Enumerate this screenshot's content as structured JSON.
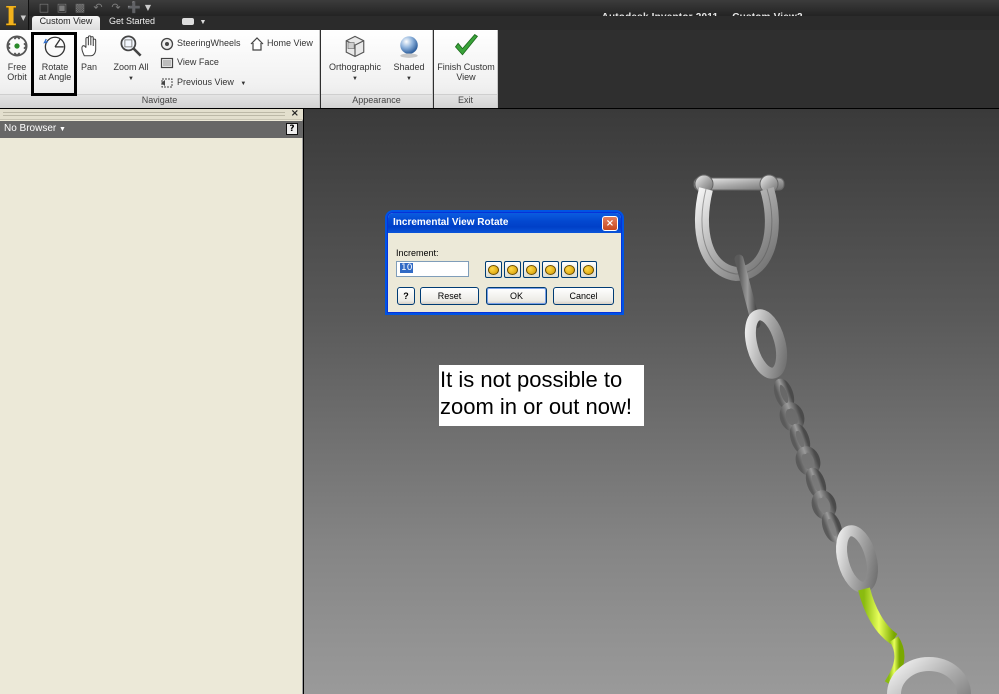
{
  "titlebar": {
    "app_name": "Autodesk Inventor 2011",
    "document": "Custom View2"
  },
  "tabs": [
    {
      "label": "Custom View",
      "active": true
    },
    {
      "label": "Get Started",
      "active": false
    }
  ],
  "ribbon": {
    "navigate": {
      "title": "Navigate",
      "free_orbit": [
        "Free",
        "Orbit"
      ],
      "rotate_at_angle": [
        "Rotate",
        "at Angle"
      ],
      "pan": "Pan",
      "zoom_all": "Zoom All",
      "steering_wheels": "SteeringWheels",
      "home_view": "Home View",
      "view_face": "View Face",
      "previous_view": "Previous View"
    },
    "appearance": {
      "title": "Appearance",
      "orthographic": "Orthographic",
      "shaded": "Shaded"
    },
    "exit": {
      "title": "Exit",
      "finish_custom_view": [
        "Finish Custom",
        "View"
      ]
    }
  },
  "browser": {
    "label": "No Browser",
    "close_symbol": "×",
    "help_symbol": "?"
  },
  "dialog": {
    "title": "Incremental View Rotate",
    "increment_label": "Increment:",
    "increment_value": "10",
    "help_symbol": "?",
    "reset_label": "Reset",
    "ok_label": "OK",
    "cancel_label": "Cancel",
    "close_symbol": "×"
  },
  "note": {
    "lines": [
      "It is not possible to",
      "zoom in or out now!"
    ]
  },
  "colors": {
    "accent_xp_blue": "#0054e3",
    "ribbon_dark": "#2f2f2f",
    "browser_bg": "#ece9d8"
  }
}
